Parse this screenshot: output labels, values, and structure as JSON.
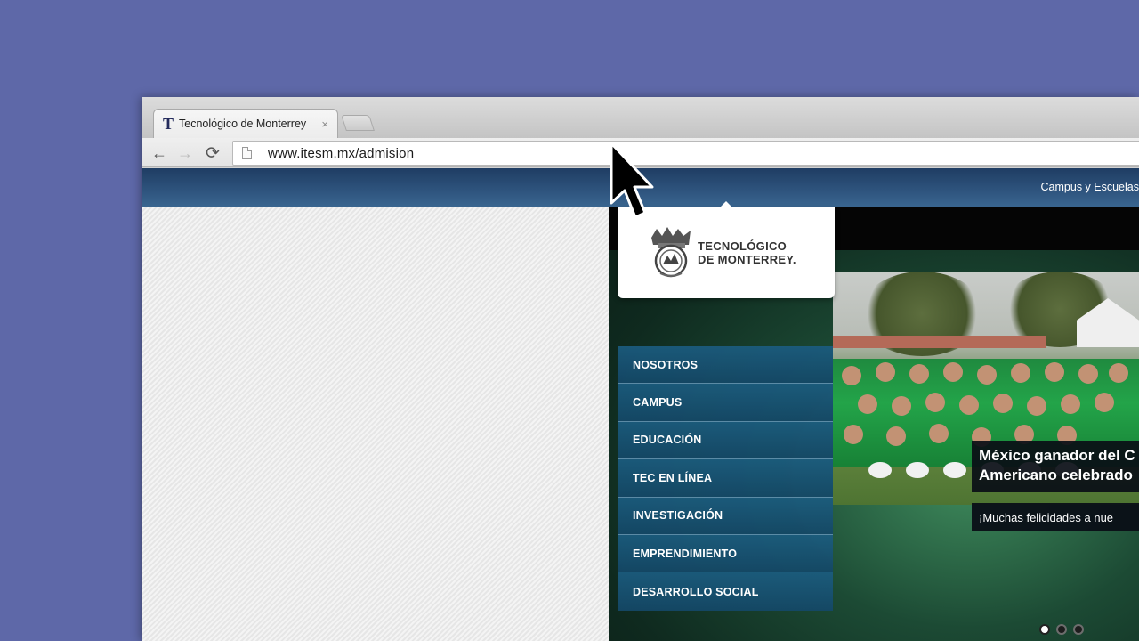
{
  "browser": {
    "tab": {
      "favicon": "T",
      "title": "Tecnológico de Monterrey",
      "close": "×"
    },
    "address": {
      "url": "www.itesm.mx/admision"
    },
    "icons": {
      "back": "←",
      "forward": "→",
      "reload": "⟳"
    }
  },
  "site": {
    "header": {
      "link_campus": "Campus y Escuelas"
    },
    "logo": {
      "line1": "TECNOLÓGICO",
      "line2": "DE MONTERREY",
      "mark": "."
    },
    "menu": [
      {
        "label": "NOSOTROS"
      },
      {
        "label": "CAMPUS"
      },
      {
        "label": "EDUCACIÓN"
      },
      {
        "label": "TEC EN LÍNEA"
      },
      {
        "label": "INVESTIGACIÓN"
      },
      {
        "label": "EMPRENDIMIENTO"
      },
      {
        "label": "DESARROLLO SOCIAL"
      }
    ],
    "slide": {
      "title_line1": "México ganador del C",
      "title_line2": "Americano celebrado",
      "subtitle": "¡Muchas felicidades a nue"
    },
    "carousel": {
      "count": 3,
      "active": 0
    }
  },
  "colors": {
    "desktop": "#5e68a8",
    "header": "#2f557f",
    "menu": "#1b5c80",
    "caption": "#0a0e16"
  }
}
